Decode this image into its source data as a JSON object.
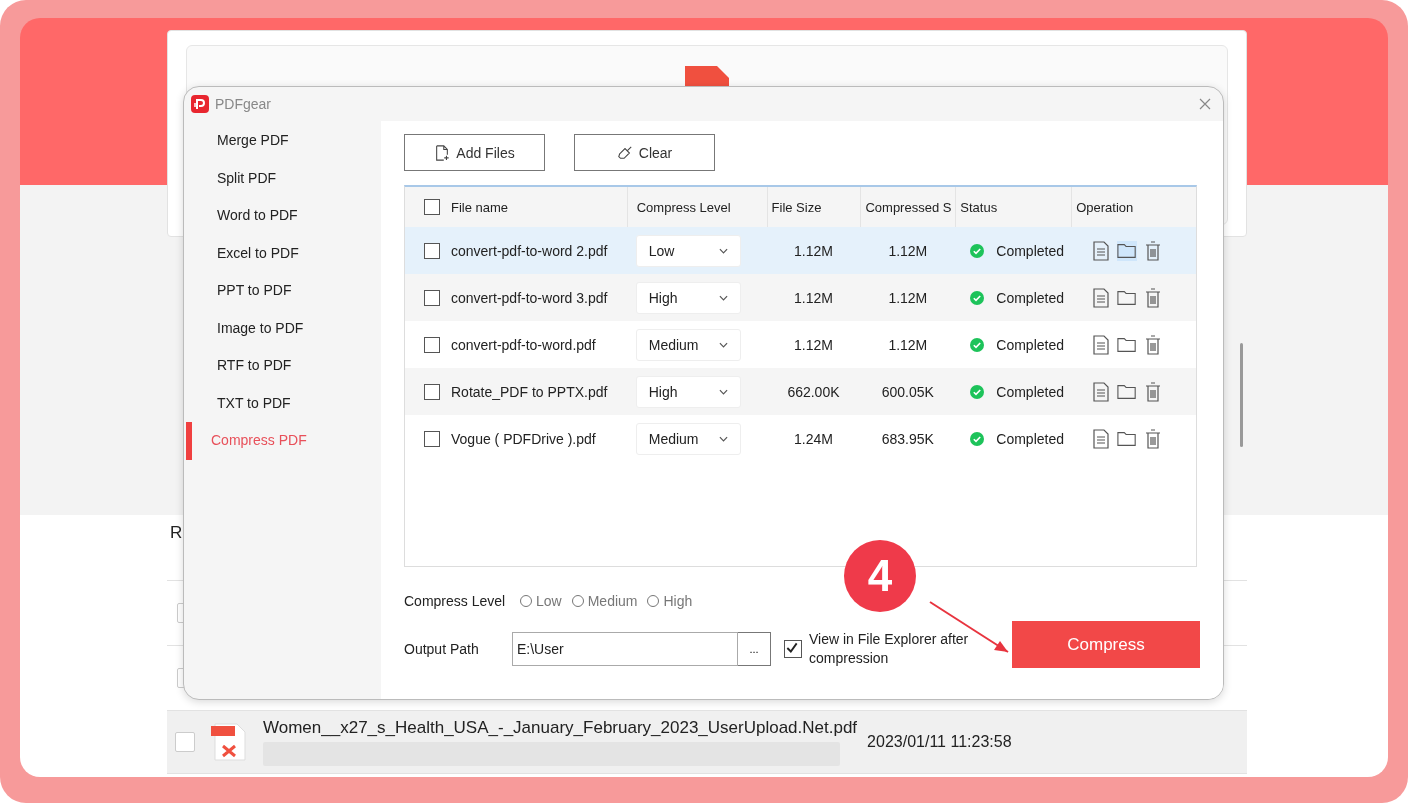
{
  "background_app": {
    "list_heading": "R",
    "rows": [
      {
        "checked": false
      },
      {
        "checked": false
      },
      {
        "checked": false,
        "file_name": "Women__x27_s_Health_USA_-_January_February_2023_UserUpload.Net.pdf",
        "date": "2023/01/11 11:23:58",
        "level": 0
      }
    ]
  },
  "dialog": {
    "title": "PDFgear",
    "sidebar": [
      {
        "label": "Merge PDF",
        "selected": false
      },
      {
        "label": "Split PDF",
        "selected": false
      },
      {
        "label": "Word to PDF",
        "selected": false
      },
      {
        "label": "Excel to PDF",
        "selected": false
      },
      {
        "label": "PPT to PDF",
        "selected": false
      },
      {
        "label": "Image to PDF",
        "selected": false
      },
      {
        "label": "RTF to PDF",
        "selected": false
      },
      {
        "label": "TXT to PDF",
        "selected": false
      },
      {
        "label": "Compress PDF",
        "selected": true
      }
    ],
    "toolbar": {
      "add_files": "Add Files",
      "clear": "Clear"
    },
    "table": {
      "header_checked": false,
      "columns": [
        "File name",
        "Compress Level",
        "File Size",
        "Compressed S",
        "Status",
        "Operation"
      ],
      "rows": [
        {
          "selected": true,
          "checked": false,
          "file_name": "convert-pdf-to-word 2.pdf",
          "level": "Low",
          "file_size": "1.12M",
          "compressed_size": "1.12M",
          "status": "Completed",
          "folder_hovered": true
        },
        {
          "selected": false,
          "checked": false,
          "file_name": "convert-pdf-to-word 3.pdf",
          "level": "High",
          "file_size": "1.12M",
          "compressed_size": "1.12M",
          "status": "Completed",
          "folder_hovered": false
        },
        {
          "selected": false,
          "checked": false,
          "file_name": "convert-pdf-to-word.pdf",
          "level": "Medium",
          "file_size": "1.12M",
          "compressed_size": "1.12M",
          "status": "Completed",
          "folder_hovered": false
        },
        {
          "selected": false,
          "checked": false,
          "file_name": "Rotate_PDF to PPTX.pdf",
          "level": "High",
          "file_size": "662.00K",
          "compressed_size": "600.05K",
          "status": "Completed",
          "folder_hovered": false
        },
        {
          "selected": false,
          "checked": false,
          "file_name": "Vogue ( PDFDrive ).pdf",
          "level": "Medium",
          "file_size": "1.24M",
          "compressed_size": "683.95K",
          "status": "Completed",
          "folder_hovered": false
        }
      ]
    },
    "compress_level": {
      "label": "Compress Level",
      "options": [
        {
          "label": "Low",
          "selected": false
        },
        {
          "label": "Medium",
          "selected": false
        },
        {
          "label": "High",
          "selected": false
        }
      ]
    },
    "output": {
      "label": "Output Path",
      "value": "E:\\User",
      "browse": "...",
      "view_checked": true,
      "view_label": "View in File Explorer after compression"
    },
    "compress_button": "Compress"
  },
  "step_badge": "4"
}
